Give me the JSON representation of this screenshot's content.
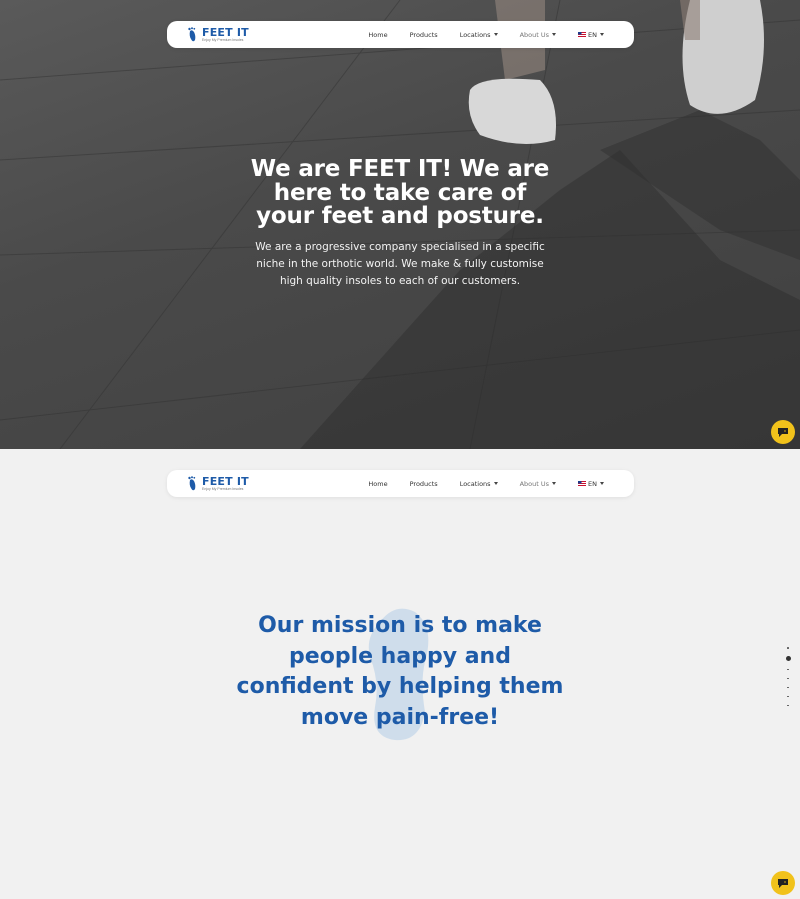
{
  "nav": {
    "logo_name": "FEET IT",
    "logo_tagline": "Enjoy My Premium Insoles",
    "items": [
      {
        "label": "Home",
        "dropdown": false
      },
      {
        "label": "Products",
        "dropdown": false
      },
      {
        "label": "Locations",
        "dropdown": true
      },
      {
        "label": "About Us",
        "dropdown": true
      }
    ],
    "language": "EN"
  },
  "hero": {
    "title": "We are FEET IT! We are here to take care of your feet and posture.",
    "subtitle": "We are a progressive company specialised in a specific niche in the orthotic world. We make & fully customise high quality insoles to each of our customers."
  },
  "mission": {
    "lines": [
      "Our mission is to make",
      "people happy and",
      "confident by helping them",
      "move pain-free!"
    ]
  },
  "colors": {
    "brand_blue": "#1e5ba8",
    "chat_yellow": "#f1c21b",
    "page_bg": "#f1f1f1"
  },
  "icons": {
    "logo": "foot-logo-icon",
    "chat": "chat-icon",
    "language": "us-flag-icon"
  }
}
